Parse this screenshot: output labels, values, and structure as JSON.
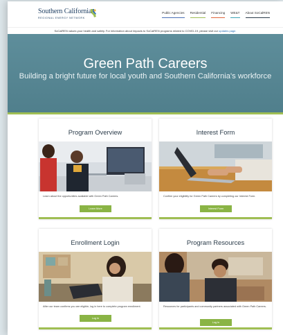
{
  "header": {
    "logo_name": "Southern California",
    "logo_tagline": "REGIONAL ENERGY NETWORK",
    "nav": [
      {
        "label": "Public Agencies",
        "color": "#4a6fb5"
      },
      {
        "label": "Residential",
        "color": "#9fbe53"
      },
      {
        "label": "Financing",
        "color": "#e0643a"
      },
      {
        "label": "WE&T",
        "color": "#3aa3b4"
      },
      {
        "label": "About SoCalREN",
        "color": "#2b3c4a"
      }
    ]
  },
  "banner": {
    "text": "SoCalREN values your health and safety. For information about impacts to SoCalREN programs related to COVID-19, please visit our",
    "link": "updates page."
  },
  "hero": {
    "title": "Green Path Careers",
    "subtitle": "Building a bright future for local youth and Southern California's workforce"
  },
  "cards": [
    {
      "title": "Program Overview",
      "description": "Learn about the opportunities available with Green Path Careers.",
      "button": "Learn More"
    },
    {
      "title": "Interest Form",
      "description": "Confirm your eligibility for Green Path Careers by completing our Interest Form.",
      "button": "Interest Form"
    },
    {
      "title": "Enrollment Login",
      "description": "After our team confirms you are eligible, log in here to complete program enrollment.",
      "button": "Log In"
    },
    {
      "title": "Program Resources",
      "description": "Resources for participants and community partners associated with Green Path Careers.",
      "button": "Log In"
    }
  ],
  "colors": {
    "hero_bg": "#5a8a97",
    "accent_green": "#9fbe53",
    "button_green": "#8ab445",
    "brand_navy": "#1f3f63"
  }
}
